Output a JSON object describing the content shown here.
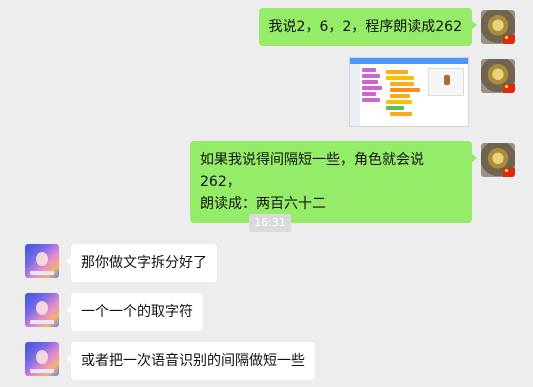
{
  "chat": {
    "messages": [
      {
        "sender": "self",
        "type": "text",
        "text": "我说2，6，2，程序朗读成262"
      },
      {
        "sender": "self",
        "type": "image",
        "image_alt": "scratch-editor-screenshot"
      },
      {
        "sender": "self",
        "type": "text",
        "lines": [
          "如果我说得间隔短一些，角色就会说262，",
          "朗读成：两百六十二"
        ]
      },
      {
        "sender": "other",
        "type": "text",
        "text": "那你做文字拆分好了"
      },
      {
        "sender": "other",
        "type": "text",
        "text": "一个一个的取字符"
      },
      {
        "sender": "other",
        "type": "text",
        "text": "或者把一次语音识别的间隔做短一些"
      }
    ],
    "time_divider": "16:31"
  },
  "colors": {
    "background": "#ededed",
    "self_bubble": "#95ec69",
    "other_bubble": "#ffffff",
    "time_badge": "#dadada"
  },
  "icons": {
    "self_avatar": "sunflower-avatar-icon",
    "flag": "china-flag-icon",
    "other_avatar": "anime-avatar-icon"
  }
}
